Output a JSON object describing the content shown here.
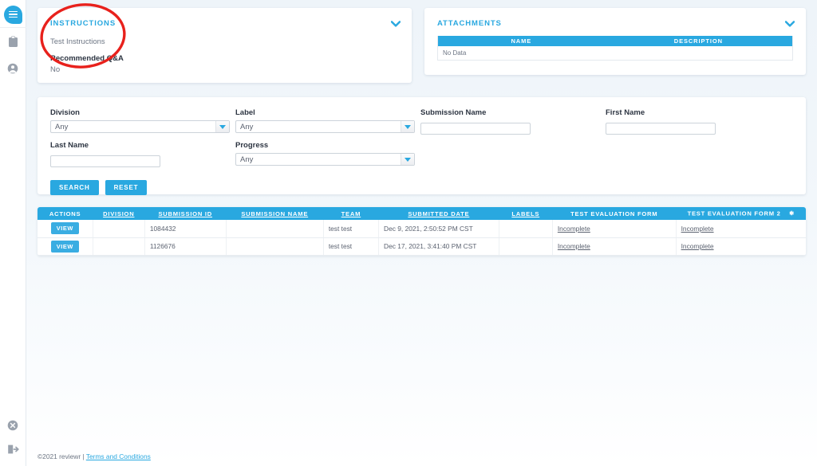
{
  "sidebar": {
    "logo_icon": "chat-bubble-logo-icon",
    "items": [
      {
        "icon": "clipboard-icon",
        "name": "sidebar-item-clipboard"
      },
      {
        "icon": "user-circle-icon",
        "name": "sidebar-item-profile"
      }
    ],
    "bottom_items": [
      {
        "icon": "close-circle-icon",
        "name": "sidebar-item-close"
      },
      {
        "icon": "logout-icon",
        "name": "sidebar-item-logout"
      }
    ]
  },
  "instructions_panel": {
    "title": "INSTRUCTIONS",
    "body": "Test Instructions",
    "qa_heading": "Recommended Q&A",
    "qa_value": "No",
    "collapse_icon": "chevron-down-icon"
  },
  "attachments_panel": {
    "title": "ATTACHMENTS",
    "collapse_icon": "chevron-down-icon",
    "columns": [
      "NAME",
      "DESCRIPTION"
    ],
    "empty_text": "No Data"
  },
  "filters": {
    "division": {
      "label": "Division",
      "value": "Any"
    },
    "label": {
      "label": "Label",
      "value": "Any"
    },
    "submission_name": {
      "label": "Submission Name",
      "value": "",
      "placeholder": ""
    },
    "first_name": {
      "label": "First Name",
      "value": "",
      "placeholder": ""
    },
    "last_name": {
      "label": "Last Name",
      "value": "",
      "placeholder": ""
    },
    "progress": {
      "label": "Progress",
      "value": "Any"
    },
    "search_button": "SEARCH",
    "reset_button": "RESET"
  },
  "table": {
    "columns": [
      {
        "label": "ACTIONS",
        "sortable": false
      },
      {
        "label": "DIVISION",
        "sortable": true
      },
      {
        "label": "SUBMISSION ID",
        "sortable": true
      },
      {
        "label": "SUBMISSION NAME",
        "sortable": true
      },
      {
        "label": "TEAM",
        "sortable": true
      },
      {
        "label": "SUBMITTED DATE",
        "sortable": true
      },
      {
        "label": "LABELS",
        "sortable": true
      },
      {
        "label": "TEST EVALUATION FORM",
        "sortable": false
      },
      {
        "label": "TEST EVALUATION FORM 2",
        "sortable": false,
        "icon": "gear-icon"
      }
    ],
    "action_label": "VIEW",
    "rows": [
      {
        "division": "",
        "submission_id": "1084432",
        "submission_name": "",
        "team": "test test",
        "submitted_date": "Dec 9, 2021, 2:50:52 PM CST",
        "labels": "",
        "form1": "Incomplete",
        "form2": "Incomplete"
      },
      {
        "division": "",
        "submission_id": "1126676",
        "submission_name": "",
        "team": "test test",
        "submitted_date": "Dec 17, 2021, 3:41:40 PM CST",
        "labels": "",
        "form1": "Incomplete",
        "form2": "Incomplete"
      }
    ]
  },
  "footer": {
    "copyright": "©2021 reviewr |",
    "terms_link": "Terms and Conditions"
  },
  "colors": {
    "accent": "#29a8e0",
    "annotation": "#e8211c",
    "text": "#5b6270"
  }
}
